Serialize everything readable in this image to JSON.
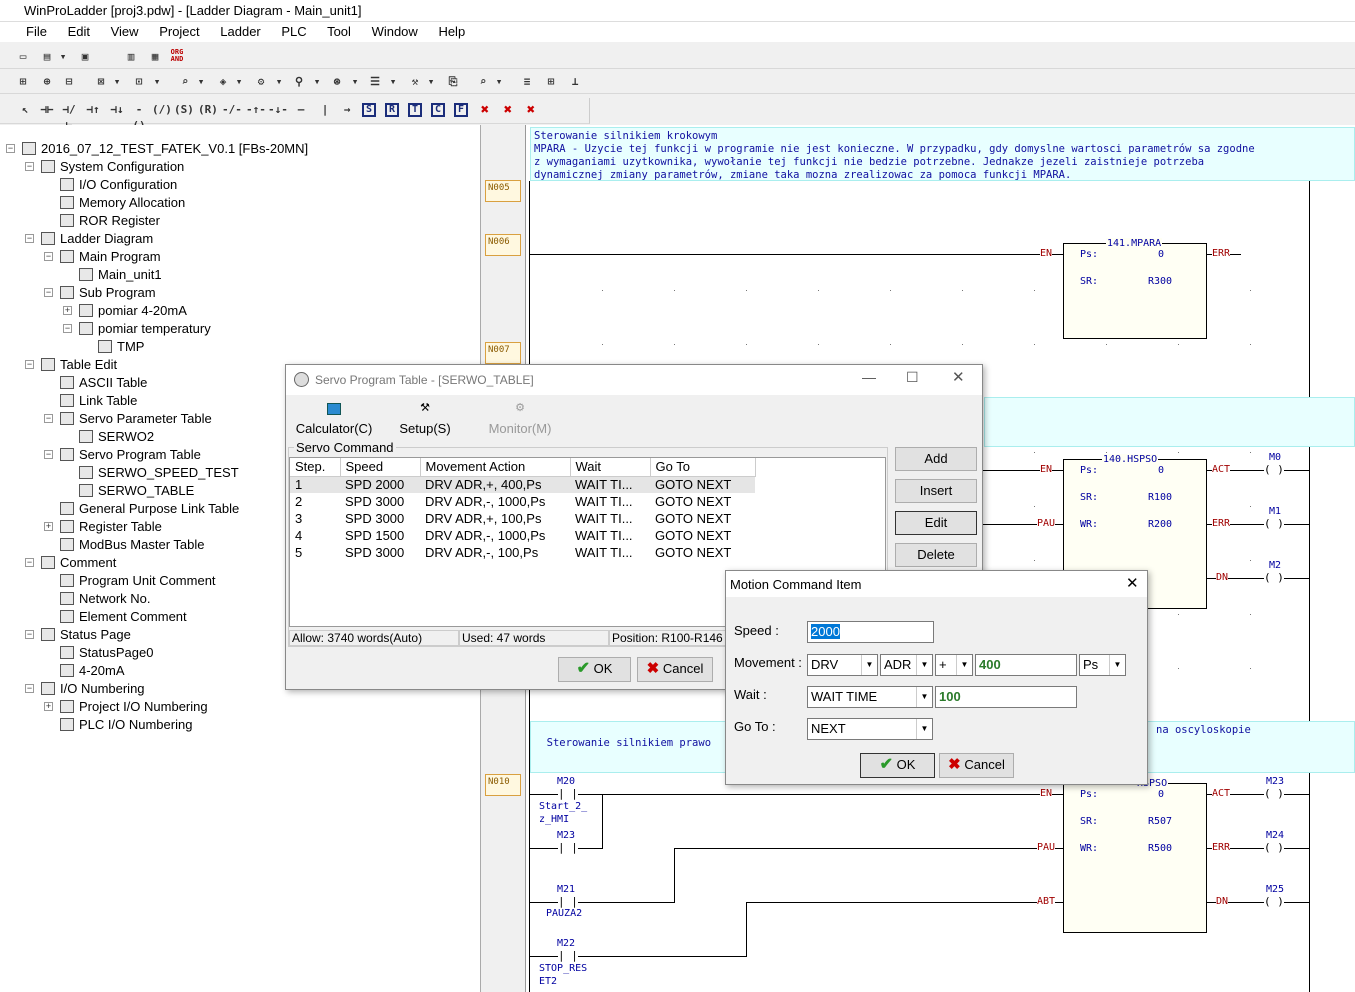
{
  "window": {
    "title": "WinProLadder [proj3.pdw] - [Ladder Diagram - Main_unit1]"
  },
  "menu": [
    "File",
    "Edit",
    "View",
    "Project",
    "Ladder",
    "PLC",
    "Tool",
    "Window",
    "Help"
  ],
  "toolbar": {
    "org_and": [
      "ORG",
      "AND"
    ],
    "row3_letters": [
      "S",
      "R",
      "T",
      "C",
      "F"
    ]
  },
  "tree": {
    "items": [
      {
        "label": "2016_07_12_TEST_FATEK_V0.1 [FBs-20MN]",
        "icon": "project-icon"
      },
      {
        "label": "System Configuration",
        "icon": "system-config-icon"
      },
      {
        "label": "I/O Configuration",
        "icon": "io-config-icon"
      },
      {
        "label": "Memory Allocation",
        "icon": "memory-icon"
      },
      {
        "label": "ROR Register",
        "icon": "register-icon"
      },
      {
        "label": "Ladder Diagram",
        "icon": "ladder-icon"
      },
      {
        "label": "Main Program",
        "icon": "program-icon"
      },
      {
        "label": "Main_unit1",
        "icon": "unit-icon"
      },
      {
        "label": "Sub Program",
        "icon": "program-icon"
      },
      {
        "label": "pomiar 4-20mA",
        "icon": "unit-icon"
      },
      {
        "label": "pomiar temperatury",
        "icon": "unit-icon"
      },
      {
        "label": "TMP",
        "icon": "pencil-icon"
      },
      {
        "label": "Table Edit",
        "icon": "table-icon"
      },
      {
        "label": "ASCII Table",
        "icon": "ascii-icon"
      },
      {
        "label": "Link Table",
        "icon": "link-icon"
      },
      {
        "label": "Servo Parameter Table",
        "icon": "servo-icon"
      },
      {
        "label": "SERWO2",
        "icon": "servo-icon"
      },
      {
        "label": "Servo Program Table",
        "icon": "servo-icon"
      },
      {
        "label": "SERWO_SPEED_TEST",
        "icon": "servo-icon"
      },
      {
        "label": "SERWO_TABLE",
        "icon": "servo-icon"
      },
      {
        "label": "General Purpose Link Table",
        "icon": "link-icon"
      },
      {
        "label": "Register Table",
        "icon": "register-icon"
      },
      {
        "label": "ModBus Master Table",
        "icon": "modbus-icon"
      },
      {
        "label": "Comment",
        "icon": "comment-icon"
      },
      {
        "label": "Program Unit Comment",
        "icon": "comment-icon"
      },
      {
        "label": "Network No.",
        "icon": "network-icon"
      },
      {
        "label": "Element Comment",
        "icon": "comment-icon"
      },
      {
        "label": "Status Page",
        "icon": "status-icon"
      },
      {
        "label": "StatusPage0",
        "icon": "page-icon"
      },
      {
        "label": "4-20mA",
        "icon": "page-icon"
      },
      {
        "label": "I/O Numbering",
        "icon": "io-num-icon"
      },
      {
        "label": "Project I/O Numbering",
        "icon": "io-num-icon"
      },
      {
        "label": "PLC I/O Numbering",
        "icon": "io-num-icon"
      }
    ]
  },
  "ladder": {
    "comment1": "Sterowanie silnikiem krokowym\nMPARA - Uzycie tej funkcji w programie nie jest konieczne. W przypadku, gdy domyslne wartosci parametrów sa zgodne\nz wymaganiami uzytkownika, wywołanie tej funkcji nie bedzie potrzebne. Jednakze jezeli zaistnieje potrzeba\ndynamicznej zmiany parametrów, zmiane taka mozna zrealizowac za pomoca funkcji MPARA.",
    "comment2a": "Sterowanie silnikiem prawo",
    "comment2b": "na oscyloskopie",
    "networks": [
      "N005",
      "N006",
      "N007",
      "N010"
    ],
    "fb1": {
      "title": "141.MPARA",
      "en": "EN",
      "err": "ERR",
      "ps_lbl": "Ps:",
      "ps": "0",
      "sr_lbl": "SR:",
      "sr": "R300"
    },
    "fb2": {
      "title": "140.HSPSO",
      "en": "EN",
      "pau": "PAU",
      "act": "ACT",
      "err": "ERR",
      "dn": "DN",
      "ps_lbl": "Ps:",
      "ps": "0",
      "sr_lbl": "SR:",
      "sr": "R100",
      "wr_lbl": "WR:",
      "wr": "R200",
      "m0": "M0",
      "m1": "M1",
      "m2": "M2"
    },
    "fb3": {
      "title": "HSPSO",
      "en": "EN",
      "pau": "PAU",
      "abt": "ABT",
      "act": "ACT",
      "err": "ERR",
      "dn": "DN",
      "ps_lbl": "Ps:",
      "ps": "0",
      "sr_lbl": "SR:",
      "sr": "R507",
      "wr_lbl": "WR:",
      "wr": "R500",
      "m23": "M23",
      "m24": "M24",
      "m25": "M25"
    },
    "contacts": [
      {
        "addr": "M20",
        "name": "Start_2_\nz_HMI"
      },
      {
        "addr": "M23",
        "name": ""
      },
      {
        "addr": "M21",
        "name": "PAUZA2"
      },
      {
        "addr": "M22",
        "name": "STOP_RES\nET2"
      }
    ]
  },
  "servo_dialog": {
    "title": "Servo Program Table - [SERWO_TABLE]",
    "tabs": {
      "calculator": "Calculator(C)",
      "setup": "Setup(S)",
      "monitor": "Monitor(M)"
    },
    "group": "Servo Command",
    "columns": [
      "Step.",
      "Speed",
      "Movement Action",
      "Wait",
      "Go To"
    ],
    "rows": [
      [
        "1",
        "SPD 2000",
        "DRV  ADR,+, 400,Ps",
        "WAIT TI...",
        "GOTO NEXT"
      ],
      [
        "2",
        "SPD 3000",
        "DRV  ADR,-, 1000,Ps",
        "WAIT TI...",
        "GOTO NEXT"
      ],
      [
        "3",
        "SPD 3000",
        "DRV  ADR,+, 100,Ps",
        "WAIT TI...",
        "GOTO NEXT"
      ],
      [
        "4",
        "SPD 1500",
        "DRV  ADR,-, 1000,Ps",
        "WAIT TI...",
        "GOTO NEXT"
      ],
      [
        "5",
        "SPD 3000",
        "DRV  ADR,-, 100,Ps",
        "WAIT TI...",
        "GOTO NEXT"
      ]
    ],
    "status": {
      "allow": "Allow: 3740 words(Auto)",
      "used": "Used: 47 words",
      "position": "Position: R100-R146"
    },
    "buttons": {
      "add": "Add",
      "insert": "Insert",
      "edit": "Edit",
      "delete": "Delete",
      "ok": "OK",
      "cancel": "Cancel"
    }
  },
  "motion_dialog": {
    "title": "Motion Command Item",
    "speed_label": "Speed :",
    "speed_value": "2000",
    "movement_label": "Movement :",
    "movement_type": "DRV",
    "movement_mode": "ADR",
    "movement_dir": "+",
    "movement_value": "400",
    "movement_unit": "Ps",
    "wait_label": "Wait :",
    "wait_type": "WAIT TIME",
    "wait_value": "100",
    "goto_label": "Go To :",
    "goto_value": "NEXT",
    "ok": "OK",
    "cancel": "Cancel"
  },
  "colors": {
    "accent": "#0078d7",
    "ladder_text": "#0000a0",
    "ok_check": "#2a9a2a",
    "cancel_x": "#cc0000"
  }
}
